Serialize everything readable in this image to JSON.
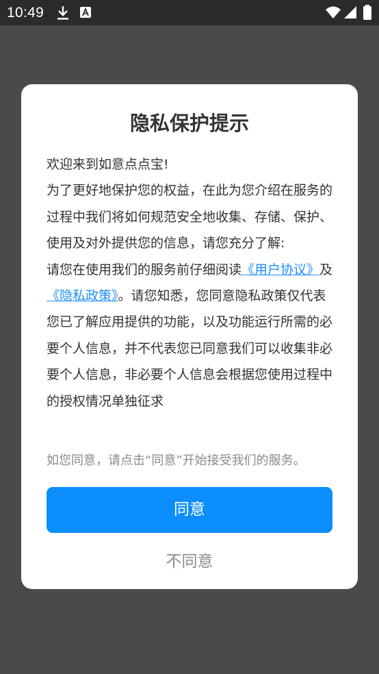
{
  "status_bar": {
    "time": "10:49",
    "icons": [
      "download-icon",
      "font-a-icon",
      "wifi-icon",
      "signal-icon",
      "battery-icon"
    ]
  },
  "dialog": {
    "title": "隐私保护提示",
    "greeting": "欢迎来到如意点点宝!",
    "intro": "为了更好地保护您的权益，在此为您介绍在服务的过程中我们将如何规范安全地收集、存储、保护、使用及对外提供您的信息，请您充分了解:",
    "read_prefix": "请您在使用我们的服务前仔细阅读",
    "user_agreement_link": "《用户协议》",
    "conjunction": "及",
    "privacy_policy_link": "《隐私政策》",
    "read_suffix": "。请您知悉，您同意隐私政策仅代表您已了解应用提供的功能，以及功能运行所需的必要个人信息，并不代表您已同意我们可以收集非必要个人信息，非必要个人信息会根据您使用过程中的授权情况单独征求",
    "consent_hint": "如您同意，请点击“同意”开始接受我们的服务。",
    "agree_label": "同意",
    "disagree_label": "不同意"
  },
  "colors": {
    "overlay": "#4a4a4a",
    "status_bar": "#2b2b2b",
    "primary": "#0d8efd",
    "link": "#1e8fff",
    "muted_text": "#8a8a8a",
    "body_text": "#333333"
  }
}
